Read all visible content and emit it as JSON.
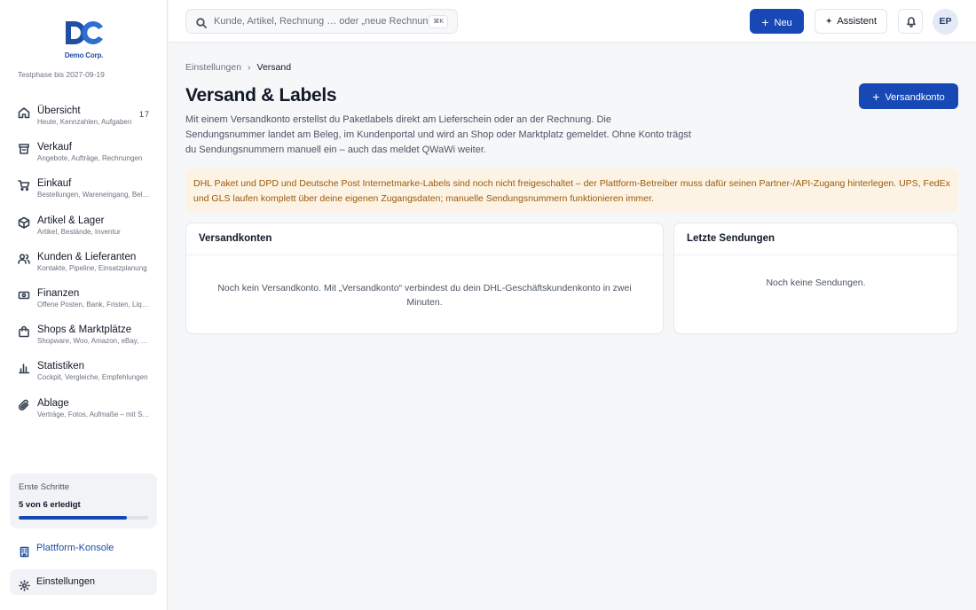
{
  "brand": {
    "mark": "DC",
    "name": "Demo Corp."
  },
  "trial_text": "Testphase bis 2027-09-19",
  "nav": [
    {
      "title": "Übersicht",
      "subtitle": "Heute, Kennzahlen, Aufgaben",
      "badge": "17",
      "icon": "home-icon"
    },
    {
      "title": "Verkauf",
      "subtitle": "Angebote, Aufträge, Rechnungen",
      "icon": "archive-icon"
    },
    {
      "title": "Einkauf",
      "subtitle": "Bestellungen, Wareneingang, Belege",
      "icon": "cart-icon"
    },
    {
      "title": "Artikel & Lager",
      "subtitle": "Artikel, Bestände, Inventur",
      "icon": "box-icon"
    },
    {
      "title": "Kunden & Lieferanten",
      "subtitle": "Kontakte, Pipeline, Einsatzplanung",
      "icon": "users-icon"
    },
    {
      "title": "Finanzen",
      "subtitle": "Offene Posten, Bank, Fristen, Liquidität",
      "icon": "money-icon"
    },
    {
      "title": "Shops & Marktplätze",
      "subtitle": "Shopware, Woo, Amazon, eBay, Kaufland",
      "icon": "bag-icon"
    },
    {
      "title": "Statistiken",
      "subtitle": "Cockpit, Vergleiche, Empfehlungen",
      "icon": "chart-icon"
    },
    {
      "title": "Ablage",
      "subtitle": "Verträge, Fotos, Aufmaße – mit Suche",
      "icon": "paperclip-icon"
    }
  ],
  "first_steps": {
    "title": "Erste Schritte",
    "count": "5 von 6 erledigt",
    "progress": 0.833
  },
  "platform_link": "Plattform-Konsole",
  "settings_link": "Einstellungen",
  "topbar": {
    "search_placeholder": "Kunde, Artikel, Rechnung … oder „neue Rechnung“",
    "search_shortcut": "⌘K",
    "new_button": "Neu",
    "assistant_button": "Assistent",
    "avatar_initials": "EP"
  },
  "breadcrumb": {
    "parent": "Einstellungen",
    "separator": "›",
    "current": "Versand"
  },
  "page": {
    "title": "Versand & Labels",
    "add_button": "Versandkonto",
    "intro": "Mit einem Versandkonto erstellst du Paketlabels direkt am Lieferschein oder an der Rechnung. Die Sendungsnummer landet am Beleg, im Kundenportal und wird an Shop oder Marktplatz gemeldet. Ohne Konto trägst du Sendungsnummern manuell ein – auch das meldet QWaWi weiter.",
    "alert": "DHL Paket und DPD und Deutsche Post Internetmarke-Labels sind noch nicht freigeschaltet – der Plattform-Betreiber muss dafür seinen Partner-/API-Zugang hinterlegen. UPS, FedEx und GLS laufen komplett über deine eigenen Zugangsdaten; manuelle Sendungsnummern funktionieren immer."
  },
  "cards": {
    "accounts": {
      "title": "Versandkonten",
      "empty": "Noch kein Versandkonto. Mit „Versandkonto“ verbindest du dein DHL-Geschäftskundenkonto in zwei Minuten."
    },
    "shipments": {
      "title": "Letzte Sendungen",
      "empty": "Noch keine Sendungen."
    }
  },
  "colors": {
    "accent": "#1848b5",
    "alert_bg": "#fdf3e4",
    "alert_text": "#9a5a0c",
    "brand": "#1f4fa3"
  }
}
